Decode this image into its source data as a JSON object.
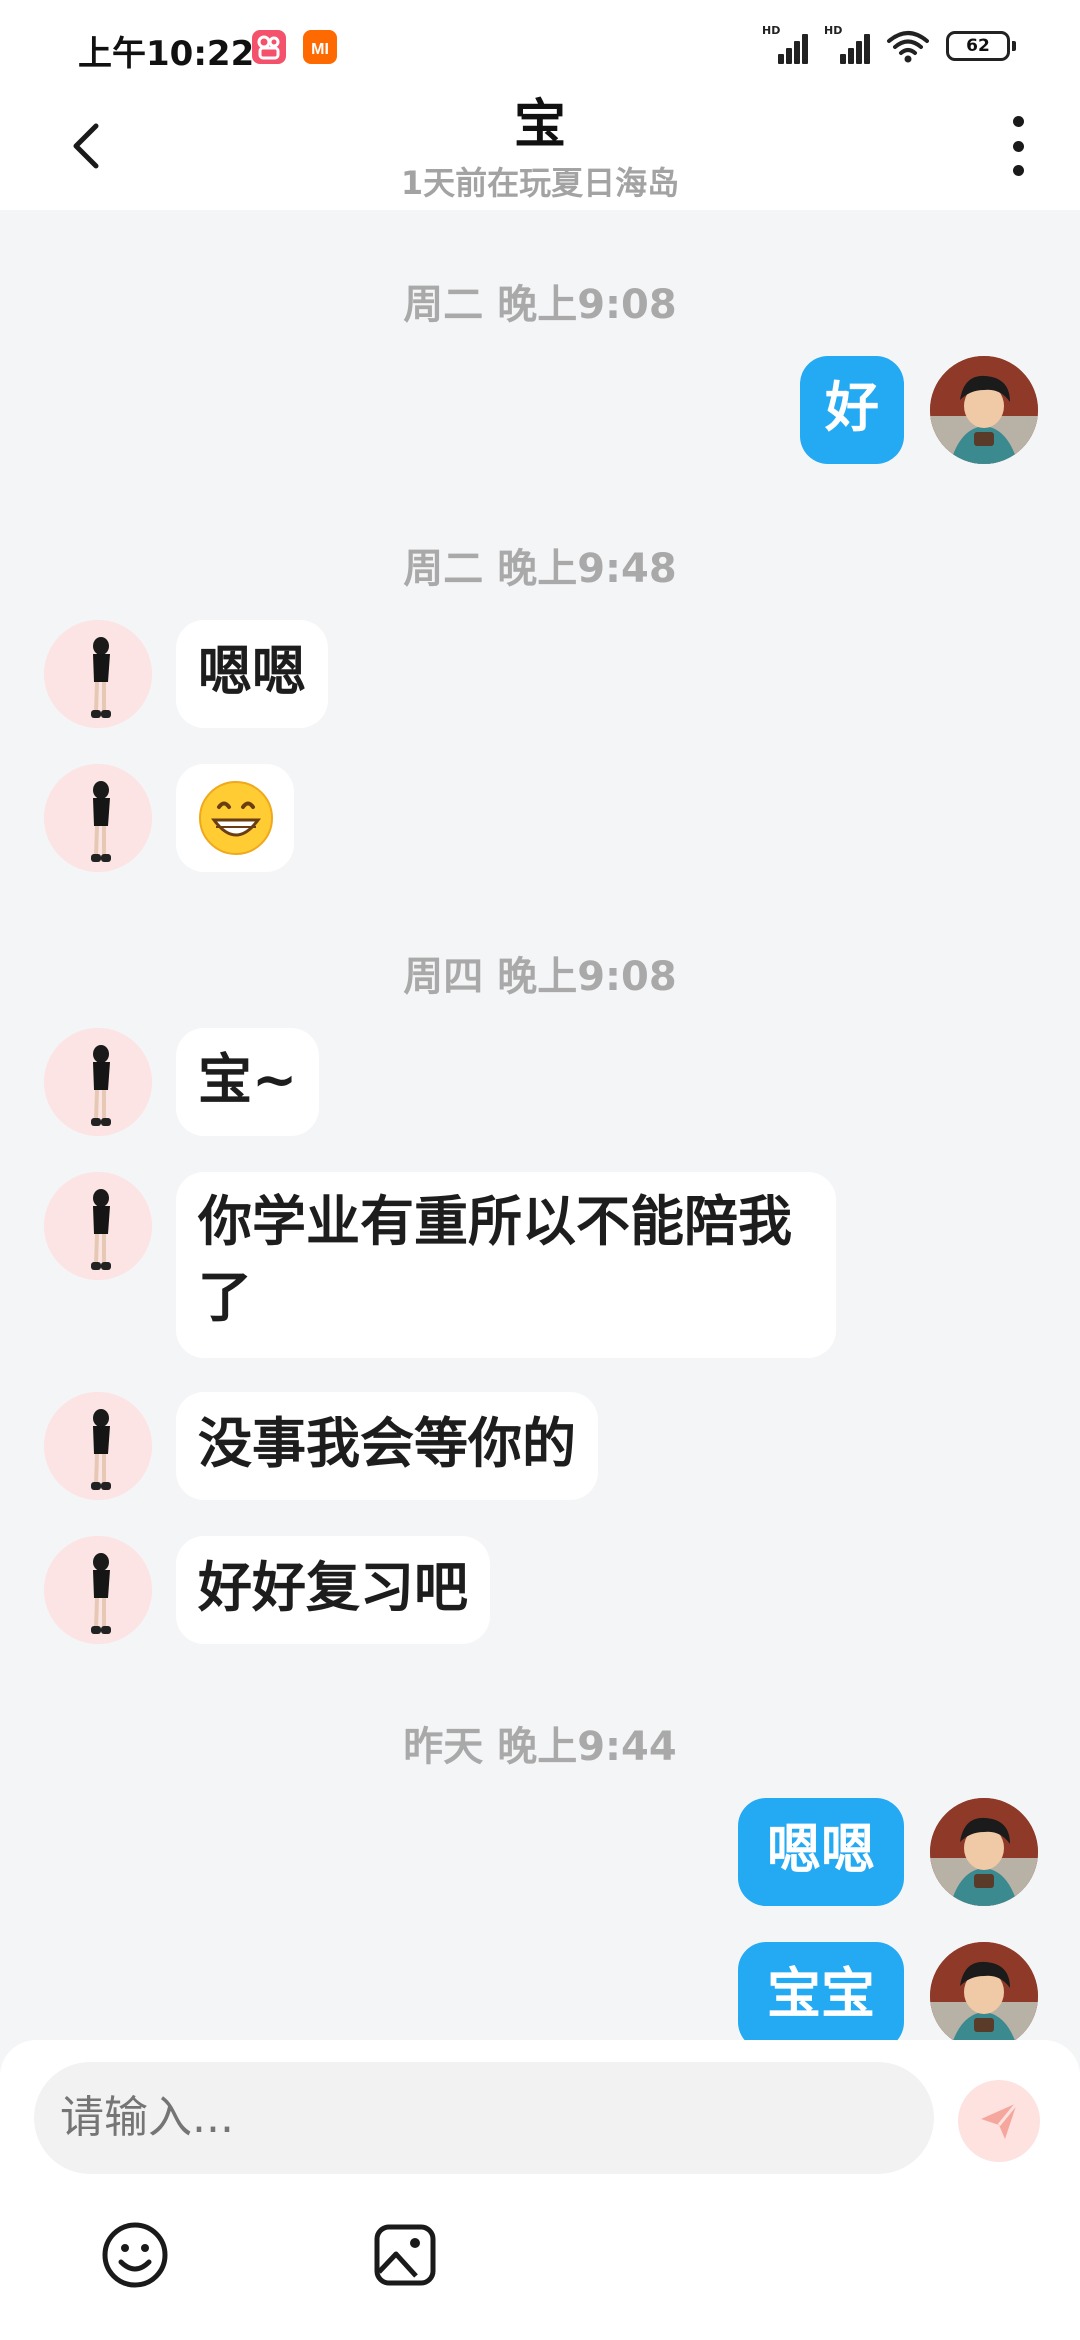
{
  "status_bar": {
    "time": "上午10:22",
    "signal_label": "HD",
    "battery": "62",
    "apps": [
      "kuaishou-icon",
      "mi-icon"
    ],
    "colors": {
      "kuaishou": "#f4516c",
      "mi": "#ff6a00"
    }
  },
  "header": {
    "back_icon": "chevron-left-icon",
    "title": "宝",
    "subtitle": "1天前在玩夏日海岛",
    "more_icon": "more-vertical-icon"
  },
  "messages": [
    {
      "timestamp": "周二 晚上9:08"
    },
    {
      "side": "out",
      "text": "好"
    },
    {
      "timestamp": "周二 晚上9:48"
    },
    {
      "side": "in",
      "text": "嗯嗯"
    },
    {
      "side": "in",
      "text": "😁"
    },
    {
      "timestamp": "周四 晚上9:08"
    },
    {
      "side": "in",
      "text": "宝~"
    },
    {
      "side": "in",
      "text": "你学业有重所以不能陪我了"
    },
    {
      "side": "in",
      "text": "没事我会等你的"
    },
    {
      "side": "in",
      "text": "好好复习吧"
    },
    {
      "timestamp": "昨天 晚上9:44"
    },
    {
      "side": "out",
      "text": "嗯嗯"
    },
    {
      "side": "out",
      "text": "宝宝"
    }
  ],
  "composer": {
    "placeholder": "请输入...",
    "send_icon": "send-icon",
    "emoji_icon": "emoji-icon",
    "image_icon": "image-icon"
  },
  "colors": {
    "outgoing_bubble": "#24a9f3",
    "incoming_bubble": "#ffffff",
    "background": "#f4f5f7"
  }
}
